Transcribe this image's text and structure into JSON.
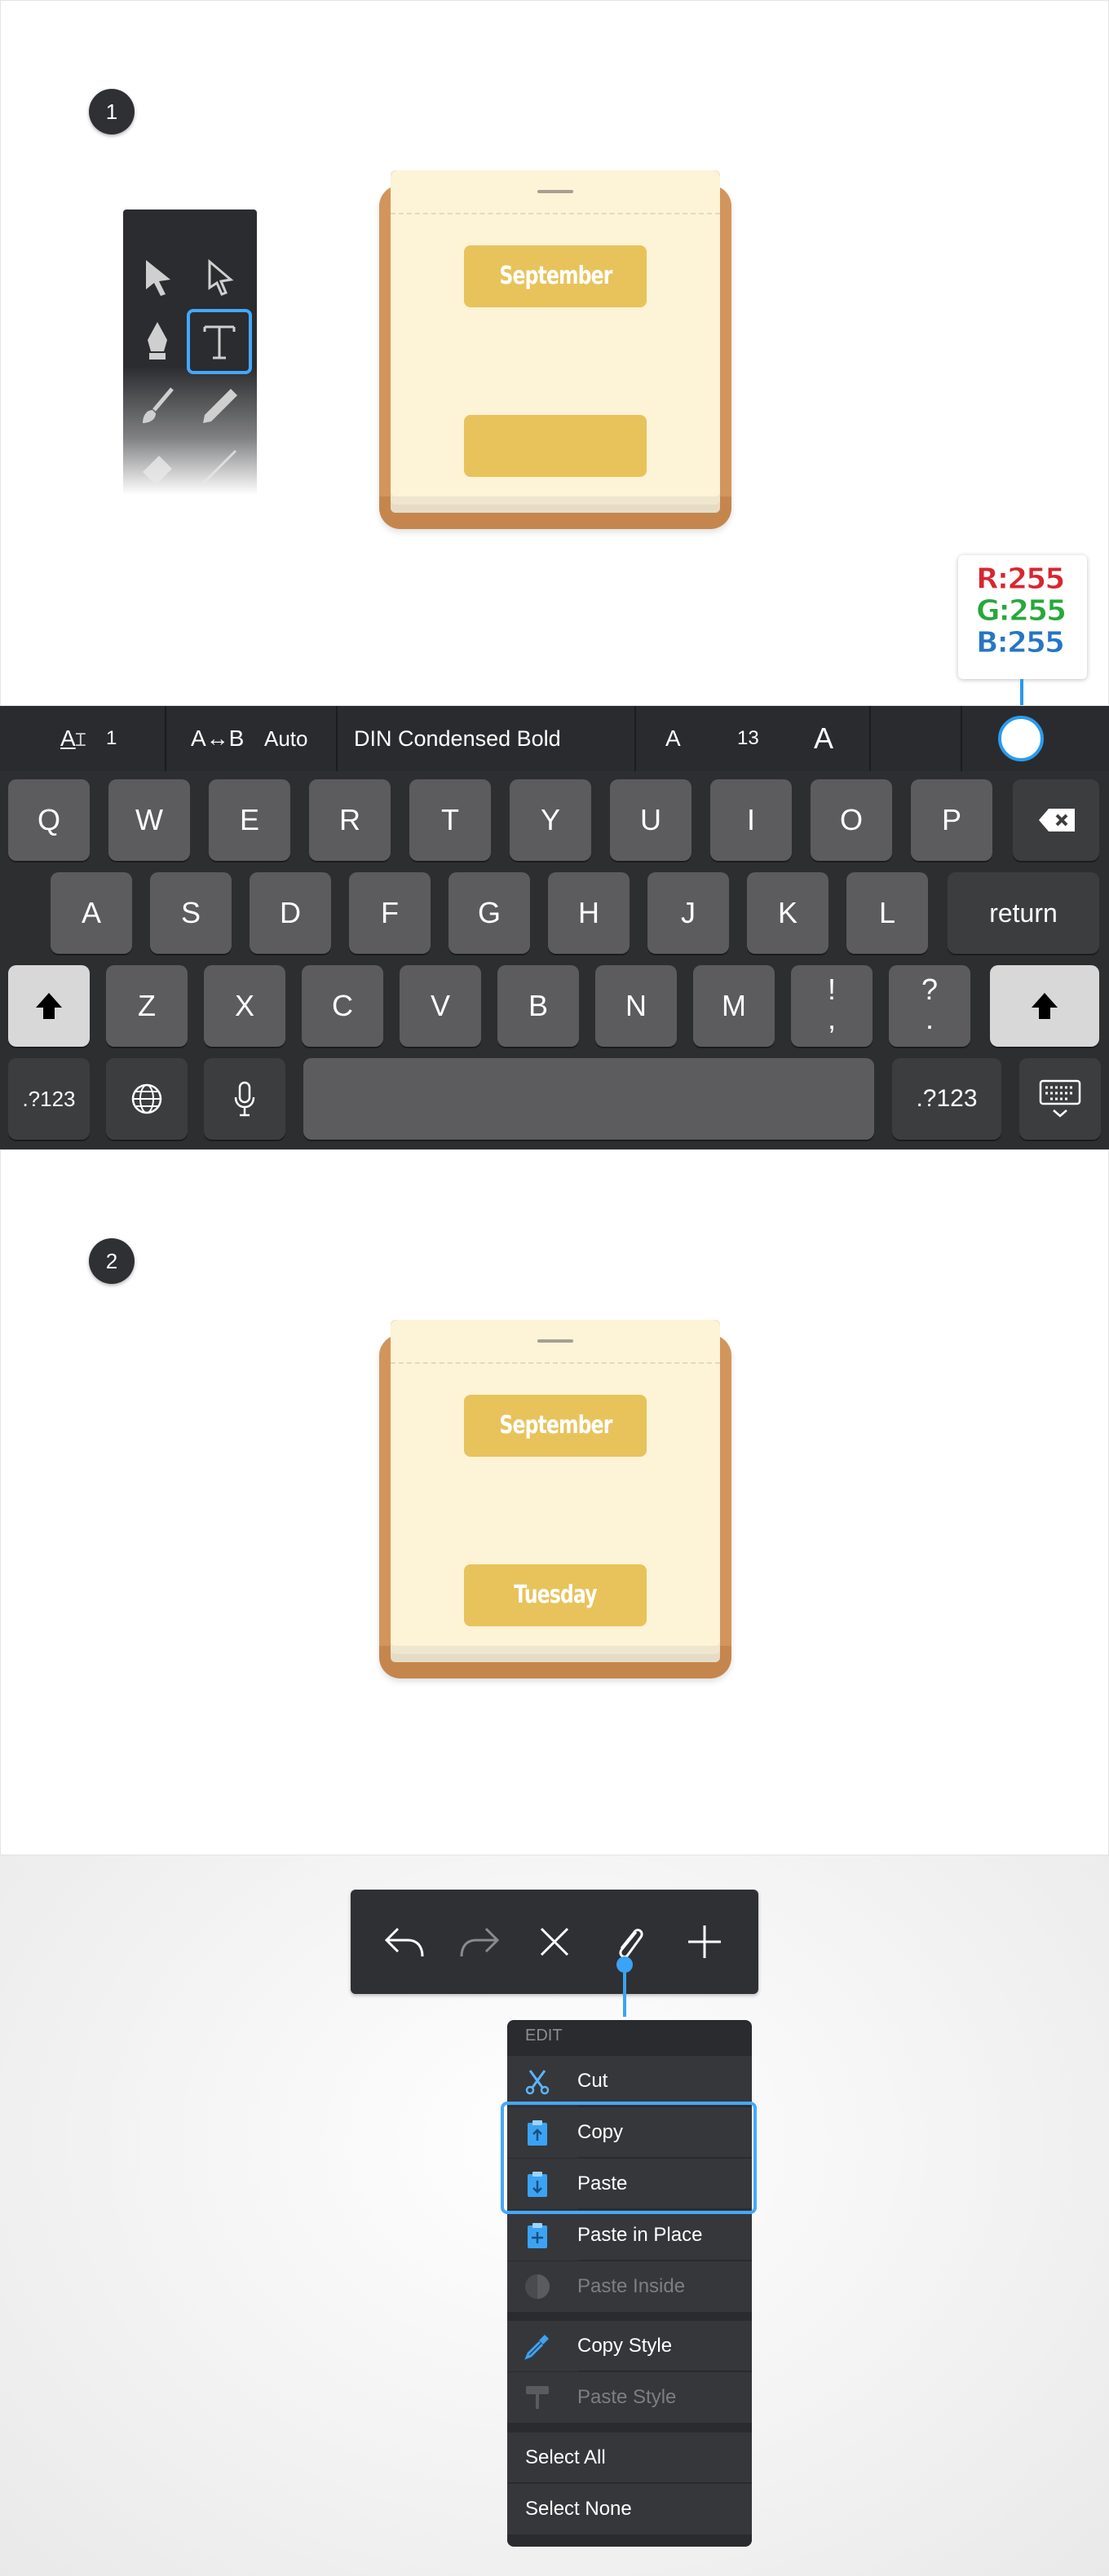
{
  "steps": {
    "one": "1",
    "two": "2"
  },
  "calendar": {
    "month": "September",
    "day": "Tuesday"
  },
  "color_badge": {
    "r": "R:255",
    "g": "G:255",
    "b": "B:255",
    "r_color": "#d8262f",
    "g_color": "#27a83b",
    "b_color": "#2676c2"
  },
  "text_toolbar": {
    "tracking": "1",
    "kerning_icon": "A↔B",
    "kerning": "Auto",
    "font": "DIN Condensed Bold",
    "size_small": "A",
    "size": "13",
    "size_large": "A",
    "align_icon": "align-left-icon",
    "accent": "#2a9af0"
  },
  "keyboard": {
    "row1": [
      "Q",
      "W",
      "E",
      "R",
      "T",
      "Y",
      "U",
      "I",
      "O",
      "P"
    ],
    "row2": [
      "A",
      "S",
      "D",
      "F",
      "G",
      "H",
      "J",
      "K",
      "L"
    ],
    "row3": [
      "Z",
      "X",
      "C",
      "V",
      "B",
      "N",
      "M",
      "!\n,",
      "?\n."
    ],
    "return": "return",
    "numbers": ".?123"
  },
  "menu": {
    "header": "EDIT",
    "cut": "Cut",
    "copy": "Copy",
    "paste": "Paste",
    "paste_in_place": "Paste in Place",
    "paste_inside": "Paste Inside",
    "copy_style": "Copy Style",
    "paste_style": "Paste Style",
    "select_all": "Select All",
    "select_none": "Select None",
    "highlight": "#44a8ff"
  }
}
